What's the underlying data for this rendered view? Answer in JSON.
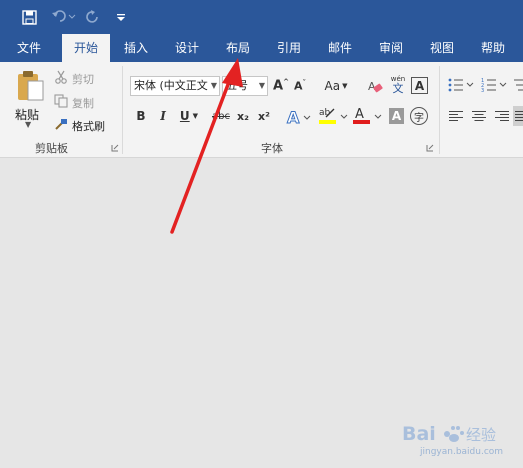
{
  "tabs": [
    {
      "label": "文件",
      "active": false
    },
    {
      "label": "开始",
      "active": true
    },
    {
      "label": "插入",
      "active": false
    },
    {
      "label": "设计",
      "active": false
    },
    {
      "label": "布局",
      "active": false
    },
    {
      "label": "引用",
      "active": false
    },
    {
      "label": "邮件",
      "active": false
    },
    {
      "label": "审阅",
      "active": false
    },
    {
      "label": "视图",
      "active": false
    },
    {
      "label": "帮助",
      "active": false
    }
  ],
  "clipboard": {
    "paste_label": "粘贴",
    "cut_label": "剪切",
    "copy_label": "复制",
    "format_painter_label": "格式刷",
    "group_label": "剪贴板"
  },
  "font": {
    "font_name": "宋体 (中文正文",
    "font_size": "五号",
    "group_label": "字体",
    "pinyin_top": "wén",
    "pinyin_bottom": "文",
    "char_border": "A",
    "case_label": "Aa",
    "bold": "B",
    "italic": "I",
    "underline": "U",
    "strikethrough": "abc",
    "subscript": "x₂",
    "superscript": "x²",
    "font_color": "A",
    "char_shading": "A",
    "enclose": "字",
    "highlight": "ab"
  },
  "colors": {
    "title_bar": "#2b579a",
    "ribbon": "#f3f3f3",
    "document": "#e6e6e6",
    "arrow": "#e32222",
    "highlight": "#ffff00",
    "font_color_bar": "#e01c1c",
    "paste_icon": "#d9a84e"
  },
  "watermark": {
    "text": "Bai 经验",
    "subtext": "jingyan.baidu.com"
  }
}
